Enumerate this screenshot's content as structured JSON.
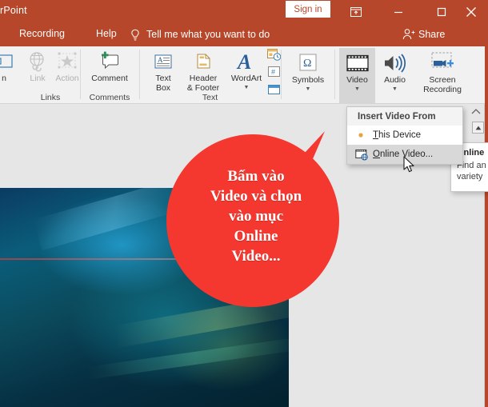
{
  "titlebar": {
    "app_title": "rPoint",
    "sign_in": "Sign in",
    "ribbon_display_icon": "ribbon-display-options-icon",
    "minimize_icon": "minimize-icon",
    "maximize_icon": "maximize-icon",
    "close_icon": "close-icon",
    "accent_color": "#b7472a"
  },
  "tabs": {
    "recording": "Recording",
    "help": "Help",
    "tell_me": "Tell me what you want to do",
    "tell_me_icon": "lightbulb-icon",
    "share": "Share",
    "share_icon": "share-person-icon"
  },
  "ribbon": {
    "groups": [
      {
        "name": "Links",
        "label": "Links",
        "items": [
          {
            "label": "Link",
            "icon": "globe-link-icon",
            "disabled": true
          },
          {
            "label": "Action",
            "icon": "action-star-icon",
            "disabled": true
          }
        ]
      },
      {
        "name": "Comments",
        "label": "Comments",
        "items": [
          {
            "label": "Comment",
            "icon": "new-comment-icon",
            "disabled": false
          }
        ]
      },
      {
        "name": "Text",
        "label": "Text",
        "items": [
          {
            "label": "Text\nBox",
            "line1": "Text",
            "line2": "Box",
            "icon": "text-box-icon",
            "disabled": false
          },
          {
            "label": "Header\n& Footer",
            "line1": "Header",
            "line2": "& Footer",
            "icon": "header-footer-icon",
            "disabled": false
          },
          {
            "label": "WordArt",
            "icon": "wordart-icon",
            "disabled": false,
            "has_caret": true
          },
          {
            "label": "",
            "icon": "date-and-time-icon",
            "disabled": false
          },
          {
            "label": "",
            "icon": "slide-number-icon",
            "disabled": false
          },
          {
            "label": "",
            "icon": "object-icon",
            "disabled": false
          }
        ]
      },
      {
        "name": "Symbols",
        "label": "",
        "items": [
          {
            "label": "Symbols",
            "icon": "omega-symbols-icon",
            "disabled": false,
            "has_caret": true
          }
        ]
      },
      {
        "name": "Media",
        "label": "",
        "items": [
          {
            "label": "Video",
            "icon": "video-filmstrip-icon",
            "disabled": false,
            "has_caret": true,
            "active": true
          },
          {
            "label": "Audio",
            "icon": "audio-speaker-icon",
            "disabled": false,
            "has_caret": true
          },
          {
            "label": "Screen\nRecording",
            "line1": "Screen",
            "line2": "Recording",
            "icon": "screen-recording-icon",
            "disabled": false
          }
        ]
      }
    ]
  },
  "dropdown": {
    "header": "Insert Video From",
    "items": [
      {
        "label": "This Device",
        "accel": "T",
        "icon": "this-device-icon",
        "highlighted": false
      },
      {
        "label": "Online Video...",
        "accel": "O",
        "icon": "online-video-icon",
        "highlighted": true
      }
    ]
  },
  "tooltip": {
    "title": "Online",
    "body": "Find an\nvariety",
    "line1": "Find an",
    "line2": "variety"
  },
  "callout": {
    "lines": [
      "Bấm vào",
      "Video và chọn",
      "vào mục",
      "Online",
      "Video..."
    ],
    "fill_color": "#f4382f",
    "text_color": "#ffffff"
  },
  "right_rail": {
    "collapse_ribbon_icon": "collapse-ribbon-chevron-icon",
    "scroll_up_icon": "scroll-up-arrow-icon"
  }
}
